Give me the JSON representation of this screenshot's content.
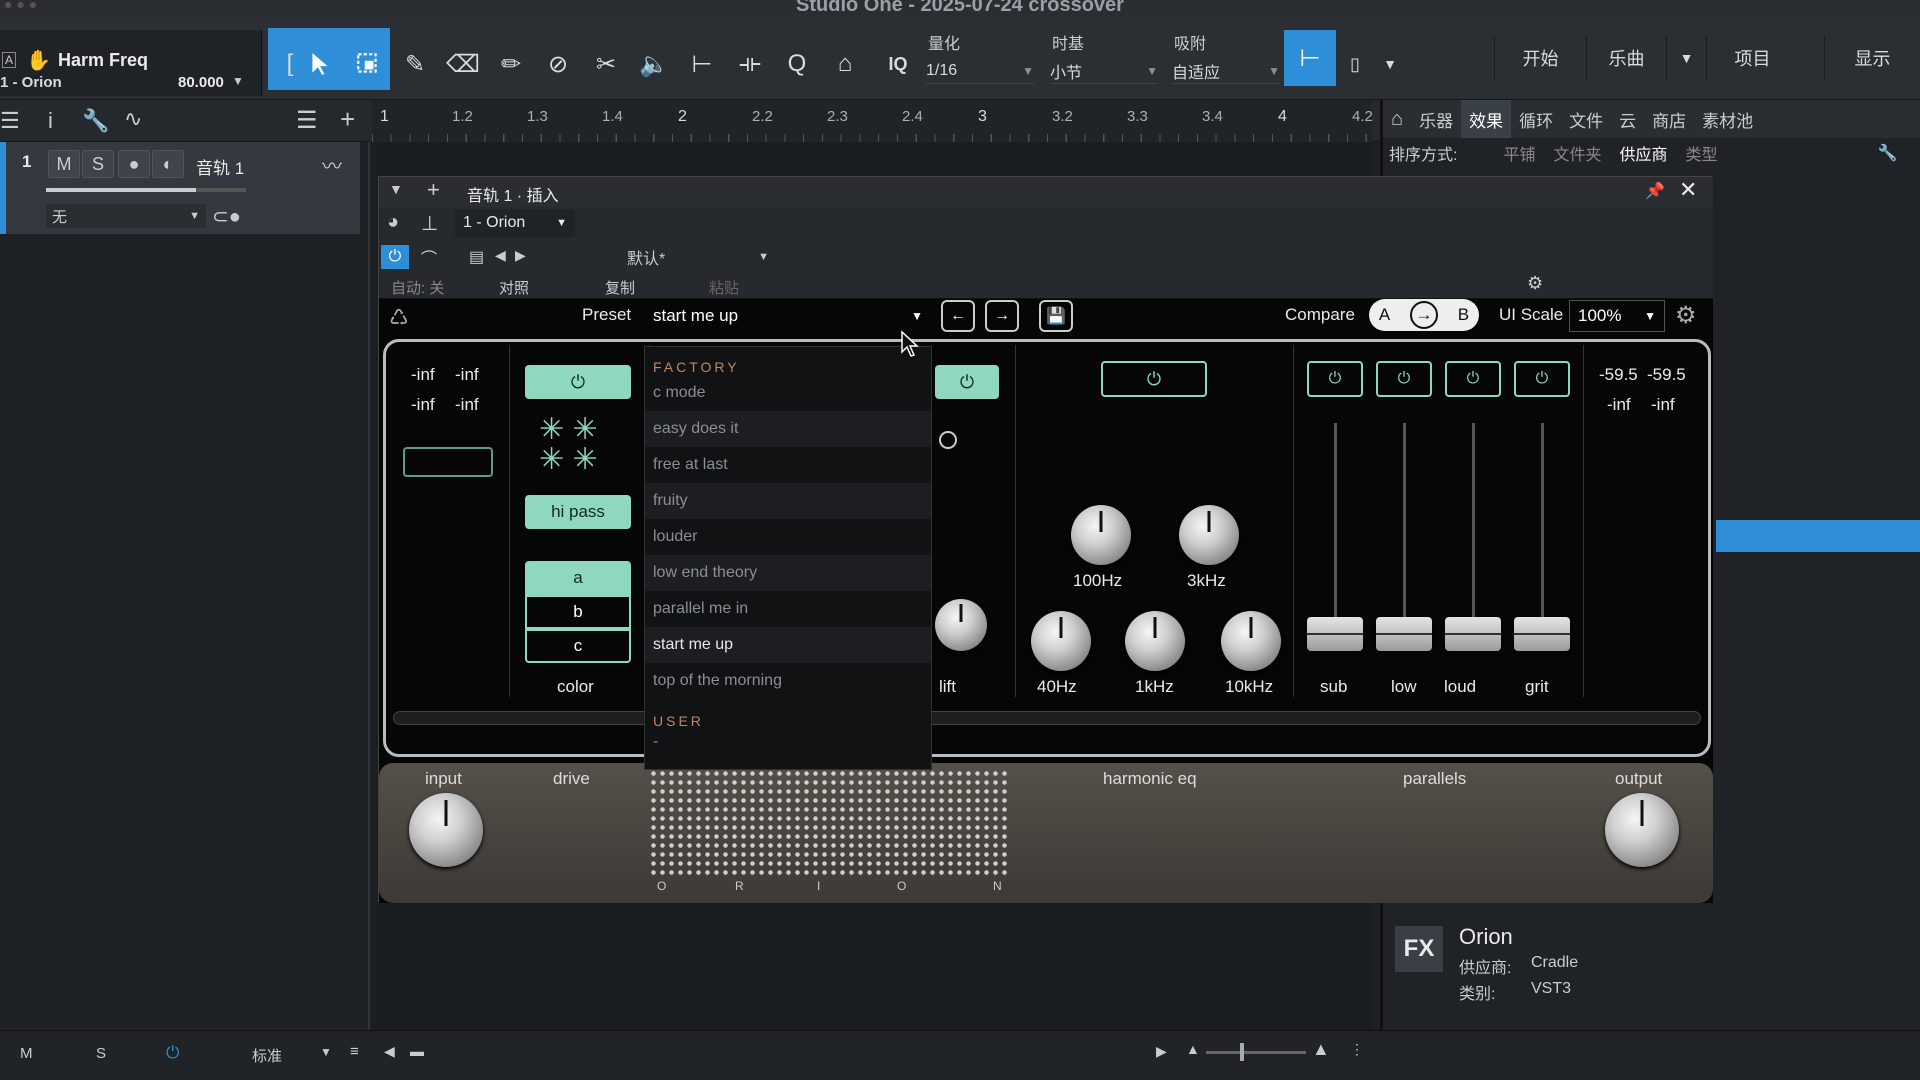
{
  "window": {
    "title": "Studio One - 2025-07-24 crossover"
  },
  "toolbar": {
    "track_name": "Harm Freq",
    "track_sub": "1 - Orion",
    "tempo": "80.000",
    "iq_label": "IQ",
    "quantize_label": "量化",
    "quantize_value": "1/16",
    "timebase_label": "时基",
    "timebase_value": "小节",
    "snap_label": "吸附",
    "snap_value": "自适应",
    "nav": [
      "开始",
      "乐曲",
      "项目",
      "显示"
    ]
  },
  "ruler": {
    "ticks": [
      "1",
      "1.2",
      "1.3",
      "1.4",
      "2",
      "2.2",
      "2.3",
      "2.4",
      "3",
      "3.2",
      "3.3",
      "3.4",
      "4",
      "4.2"
    ]
  },
  "track": {
    "number": "1",
    "m": "M",
    "s": "S",
    "name": "音轨 1",
    "input": "无"
  },
  "browser": {
    "tabs": [
      "乐器",
      "效果",
      "循环",
      "文件",
      "云",
      "商店",
      "素材池"
    ],
    "sort_label": "排序方式:",
    "sort_options": [
      "平铺",
      "文件夹",
      "供应商",
      "类型"
    ],
    "info": {
      "badge": "FX",
      "name": "Orion",
      "vendor_label": "供应商:",
      "vendor": "Cradle",
      "category_label": "类别:",
      "category": "VST3"
    }
  },
  "plugin_window": {
    "title": "音轨 1 · 插入",
    "instance": "1 - Orion",
    "preset_name": "默认*",
    "auto_label": "自动: 关",
    "compare_label": "对照",
    "copy_label": "复制",
    "paste_label": "粘贴"
  },
  "orion": {
    "preset_label": "Preset",
    "preset_value": "start me up",
    "compare_label": "Compare",
    "a_label": "A",
    "b_label": "B",
    "ui_scale_label": "UI Scale",
    "ui_scale_value": "100%",
    "meters_in": [
      "-inf",
      "-inf",
      "-inf",
      "-inf"
    ],
    "meters_out": [
      "-59.5",
      "-59.5",
      "-inf",
      "-inf"
    ],
    "hipass_label": "hi pass",
    "color_options": [
      "a",
      "b",
      "c"
    ],
    "color_label": "color",
    "lift_label": "lift",
    "eq_knobs_top": [
      "100Hz",
      "3kHz"
    ],
    "eq_knobs_bottom": [
      "40Hz",
      "1kHz",
      "10kHz"
    ],
    "faders": [
      "sub",
      "low",
      "loud",
      "grit"
    ],
    "section_labels": [
      "input",
      "drive",
      "harmonic eq",
      "parallels",
      "output"
    ],
    "brand_letters": [
      "O",
      "R",
      "I",
      "O",
      "N"
    ]
  },
  "dropdown": {
    "factory_label": "FACTORY",
    "items": [
      "c mode",
      "easy does it",
      "free at last",
      "fruity",
      "louder",
      "low end theory",
      "parallel me in",
      "start me up",
      "top of the morning"
    ],
    "selected": "start me up",
    "user_label": "USER",
    "user_items": [
      "-"
    ]
  },
  "statusbar": {
    "m": "M",
    "s": "S",
    "mode": "标准"
  },
  "colors": {
    "accent": "#2e8fd8",
    "mint": "#8fd8bf",
    "factory": "#c28562"
  }
}
